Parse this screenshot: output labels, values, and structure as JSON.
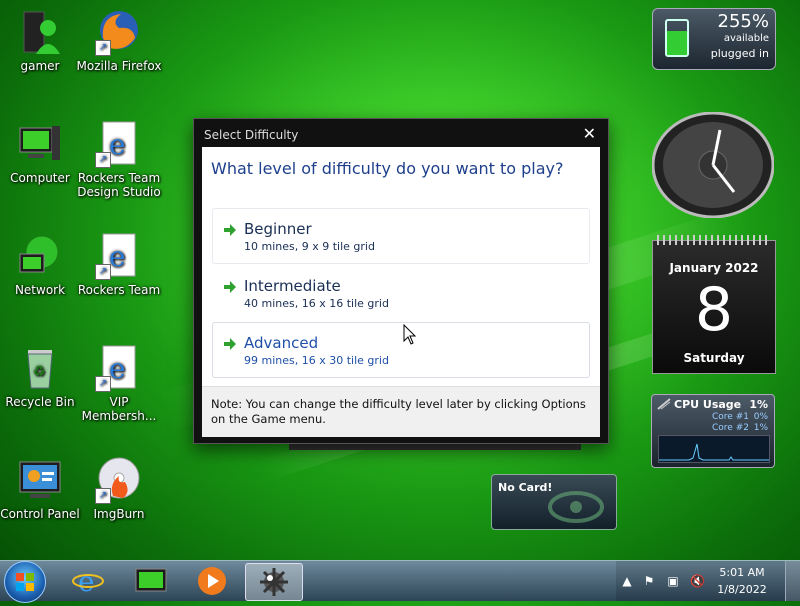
{
  "desktop": {
    "icons": [
      {
        "label": "gamer"
      },
      {
        "label": "Mozilla Firefox"
      },
      {
        "label": "Computer"
      },
      {
        "label": "Rockers Team Design Studio"
      },
      {
        "label": "Network"
      },
      {
        "label": "Rockers Team"
      },
      {
        "label": "Recycle Bin"
      },
      {
        "label": "VIP Membersh..."
      },
      {
        "label": "Control Panel"
      },
      {
        "label": "ImgBurn"
      }
    ]
  },
  "dialog": {
    "title": "Select Difficulty",
    "close_glyph": "✕",
    "question": "What level of difficulty do you want to play?",
    "options": [
      {
        "name": "Beginner",
        "desc": "10 mines, 9 x 9 tile grid"
      },
      {
        "name": "Intermediate",
        "desc": "40 mines, 16 x 16 tile grid"
      },
      {
        "name": "Advanced",
        "desc": "99 mines, 16 x 30 tile grid"
      }
    ],
    "note": "Note: You can change the difficulty level later by clicking Options on the Game menu."
  },
  "gadgets": {
    "battery": {
      "percent": "255%",
      "available": "available",
      "status": "plugged in"
    },
    "calendar": {
      "month": "January 2022",
      "day": "8",
      "weekday": "Saturday"
    },
    "cpu": {
      "title": "CPU Usage",
      "total": "1%",
      "core1_label": "Core #1",
      "core1": "0%",
      "core2_label": "Core #2",
      "core2": "1%"
    },
    "gpu": {
      "status": "No Card!"
    }
  },
  "taskbar": {
    "time": "5:01 AM",
    "date": "1/8/2022"
  },
  "colors": {
    "accent": "#1e3f8c",
    "arrow": "#2fa12f"
  }
}
